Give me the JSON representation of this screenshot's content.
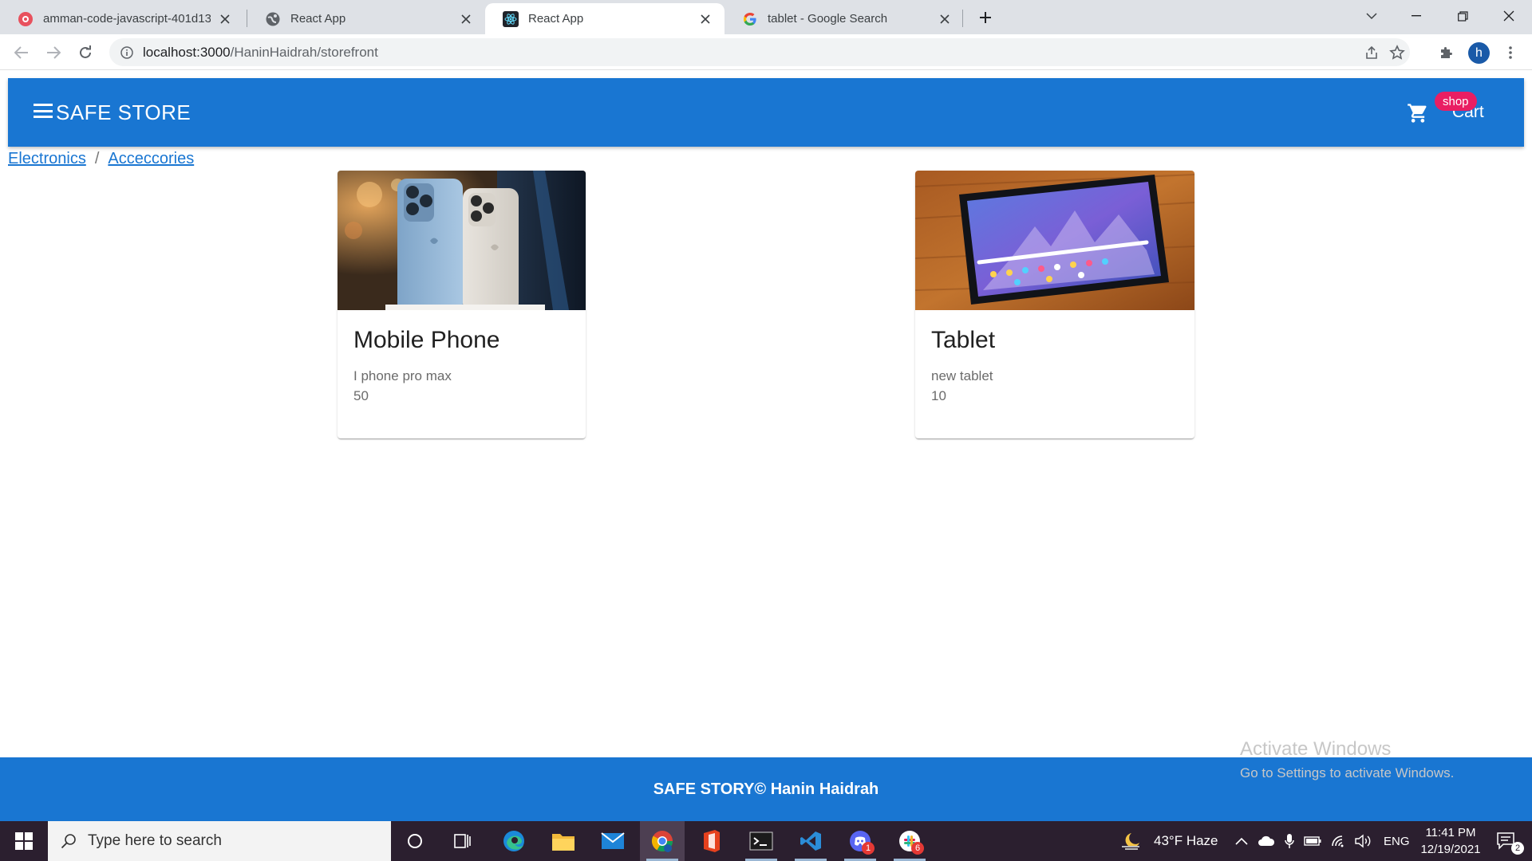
{
  "browser": {
    "tabs": [
      {
        "title": "amman-code-javascript-401d13:",
        "active": false
      },
      {
        "title": "React App",
        "active": false
      },
      {
        "title": "React App",
        "active": true
      },
      {
        "title": "tablet - Google Search",
        "active": false
      }
    ],
    "url_host": "localhost:3000",
    "url_path": "/HaninHaidrah/storefront",
    "profile_initial": "h"
  },
  "app": {
    "brand": "SAFE STORE",
    "cart_label": "Cart",
    "cart_badge": "shop",
    "primary_color": "#1976d2",
    "badge_color": "#e91e63"
  },
  "breadcrumb": {
    "items": [
      "Electronics",
      "Acceccories"
    ],
    "separator": "/"
  },
  "products": [
    {
      "title": "Mobile Phone",
      "description": "I phone pro max",
      "price": "50"
    },
    {
      "title": "Tablet",
      "description": "new tablet",
      "price": "10"
    }
  ],
  "footer": {
    "text": "SAFE STORY© Hanin Haidrah"
  },
  "watermark": {
    "line1": "Activate Windows",
    "line2": "Go to Settings to activate Windows."
  },
  "taskbar": {
    "search_placeholder": "Type here to search",
    "weather": "43°F  Haze",
    "language": "ENG",
    "time": "11:41 PM",
    "date": "12/19/2021",
    "notification_count": "2",
    "discord_badge": "1",
    "slack_badge": "6"
  }
}
